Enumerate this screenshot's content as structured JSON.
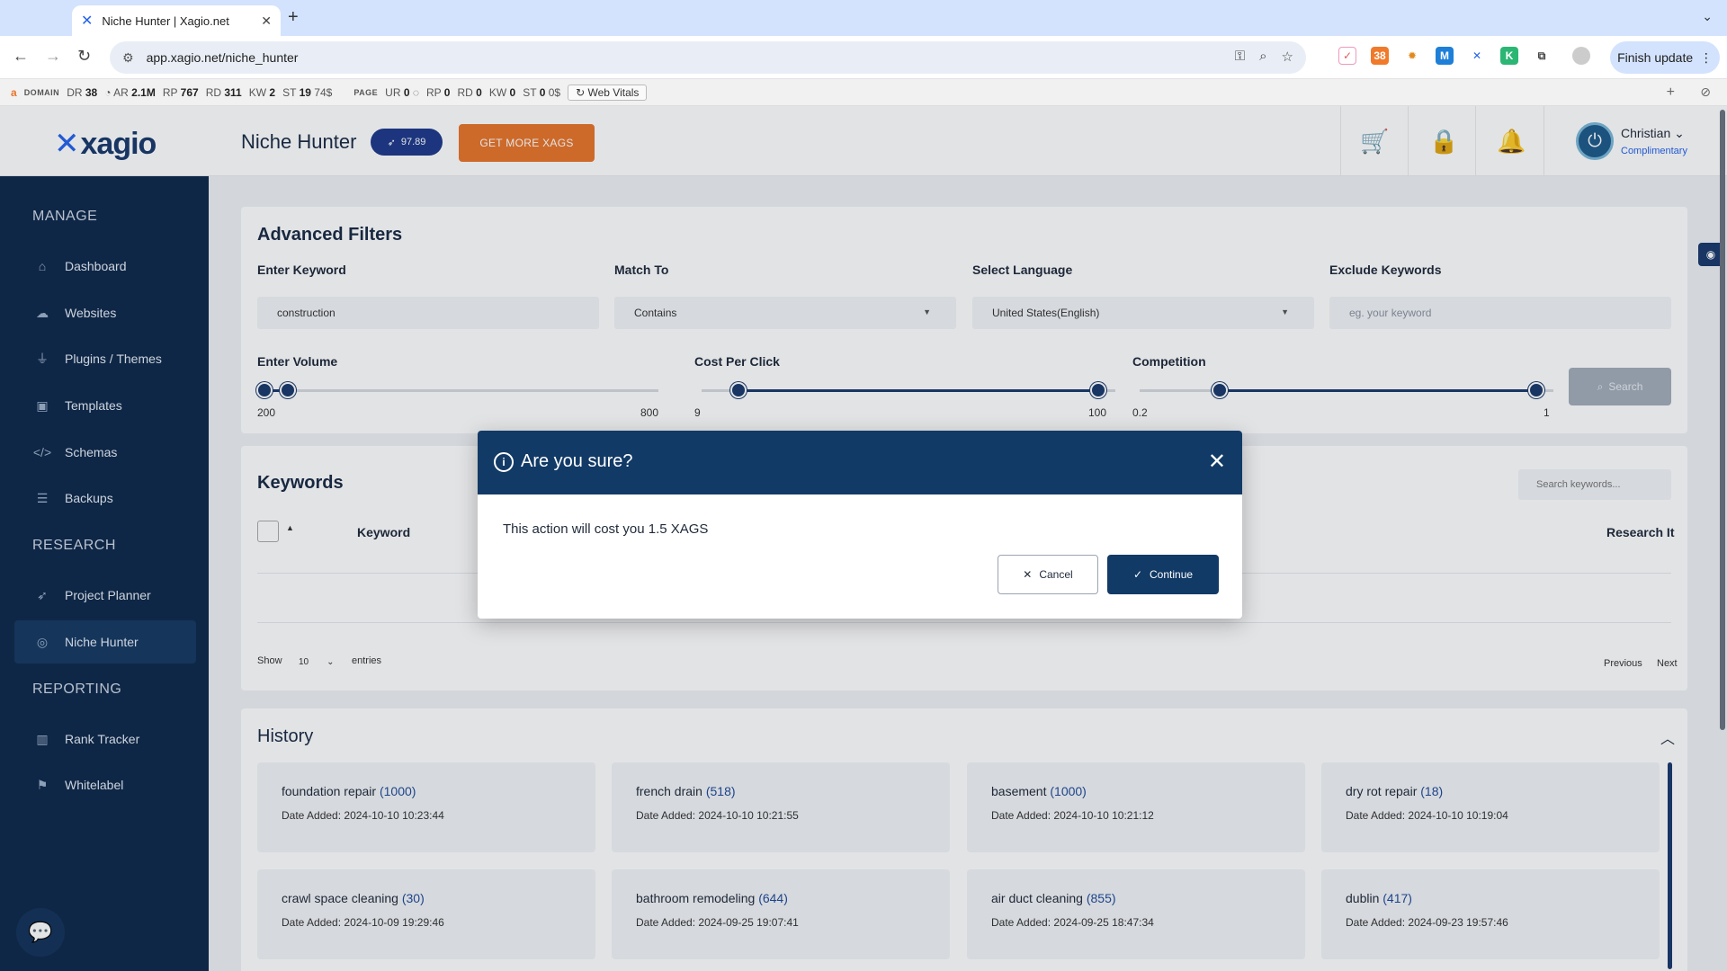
{
  "browser": {
    "tab_title": "Niche Hunter | Xagio.net",
    "url": "app.xagio.net/niche_hunter",
    "finish_update": "Finish update",
    "ext_badge": "38"
  },
  "seobar": {
    "domain_label": "DOMAIN",
    "dr_label": "DR",
    "dr": "38",
    "ar_label": "AR",
    "ar": "2.1M",
    "rp_label": "RP",
    "rp": "767",
    "rd_label": "RD",
    "rd": "311",
    "kw_label": "KW",
    "kw": "2",
    "st_label": "ST",
    "st": "19",
    "st_price": "74$",
    "page_label": "PAGE",
    "pur_label": "UR",
    "pur": "0",
    "prp_label": "RP",
    "prp": "0",
    "prd_label": "RD",
    "prd": "0",
    "pkw_label": "KW",
    "pkw": "0",
    "pst_label": "ST",
    "pst": "0",
    "pst_price": "0$",
    "web_vitals": "Web Vitals"
  },
  "header": {
    "logo": "xagio",
    "page_title": "Niche Hunter",
    "xags_balance": "97.89",
    "get_more": "GET MORE XAGS",
    "user_name": "Christian",
    "user_plan": "Complimentary"
  },
  "sidebar": {
    "sections": [
      "MANAGE",
      "RESEARCH",
      "REPORTING"
    ],
    "manage": [
      "Dashboard",
      "Websites",
      "Plugins / Themes",
      "Templates",
      "Schemas",
      "Backups"
    ],
    "research": [
      "Project Planner",
      "Niche Hunter"
    ],
    "reporting": [
      "Rank Tracker",
      "Whitelabel"
    ]
  },
  "filters": {
    "title": "Advanced Filters",
    "keyword_label": "Enter Keyword",
    "keyword_value": "construction",
    "match_label": "Match To",
    "match_value": "Contains",
    "language_label": "Select Language",
    "language_value": "United States(English)",
    "exclude_label": "Exclude Keywords",
    "exclude_placeholder": "eg. your keyword",
    "volume_label": "Enter Volume",
    "volume_min": "200",
    "volume_max": "800",
    "cpc_label": "Cost Per Click",
    "cpc_min": "9",
    "cpc_max": "100",
    "competition_label": "Competition",
    "competition_min": "0.2",
    "competition_max": "1",
    "search_button": "Search"
  },
  "keywords": {
    "title": "Keywords",
    "search_placeholder": "Search keywords...",
    "col_keyword": "Keyword",
    "col_research": "Research It",
    "show": "Show",
    "entries_value": "10",
    "entries": "entries",
    "previous": "Previous",
    "next": "Next"
  },
  "history": {
    "title": "History",
    "date_prefix": "Date Added: ",
    "items": [
      {
        "keyword": "foundation repair",
        "count": "(1000)",
        "date": "2024-10-10 10:23:44"
      },
      {
        "keyword": "french drain",
        "count": "(518)",
        "date": "2024-10-10 10:21:55"
      },
      {
        "keyword": "basement",
        "count": "(1000)",
        "date": "2024-10-10 10:21:12"
      },
      {
        "keyword": "dry rot repair",
        "count": "(18)",
        "date": "2024-10-10 10:19:04"
      },
      {
        "keyword": "crawl space cleaning",
        "count": "(30)",
        "date": "2024-10-09 19:29:46"
      },
      {
        "keyword": "bathroom remodeling",
        "count": "(644)",
        "date": "2024-09-25 19:07:41"
      },
      {
        "keyword": "air duct cleaning",
        "count": "(855)",
        "date": "2024-09-25 18:47:34"
      },
      {
        "keyword": "dublin",
        "count": "(417)",
        "date": "2024-09-23 19:57:46"
      }
    ]
  },
  "modal": {
    "title": "Are you sure?",
    "message": "This action will cost you 1.5 XAGS",
    "cancel": "Cancel",
    "continue": "Continue"
  }
}
